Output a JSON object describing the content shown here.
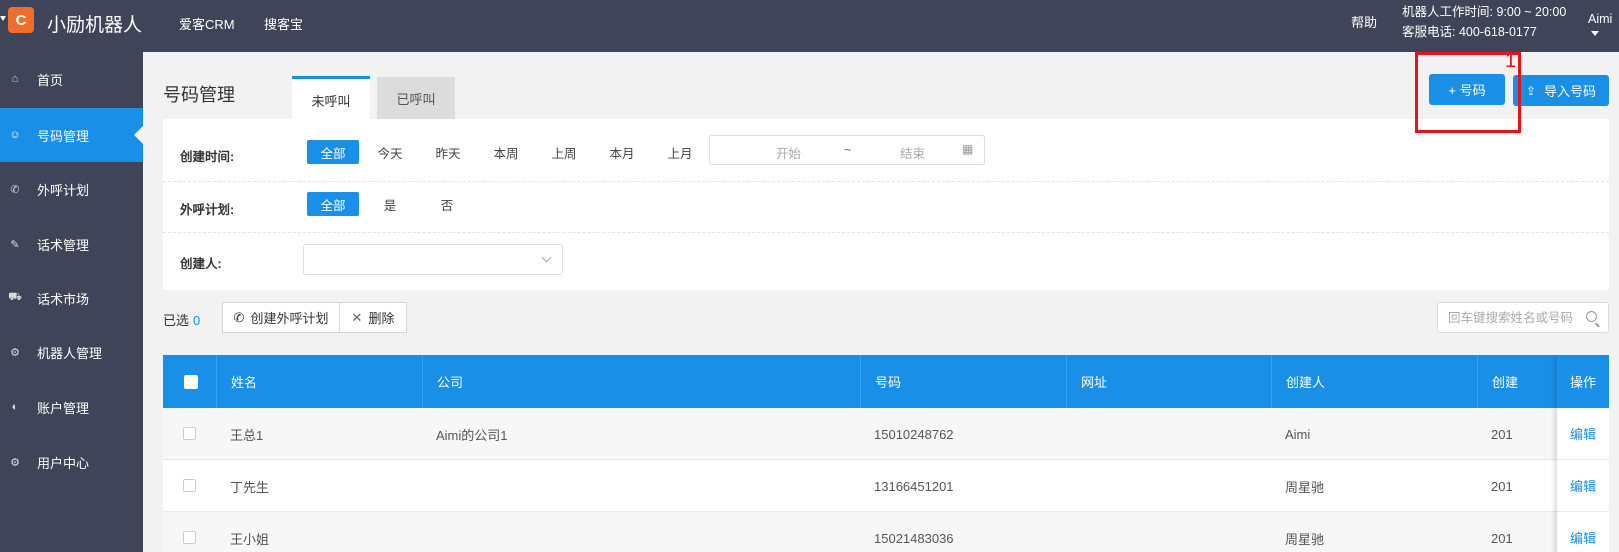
{
  "header": {
    "app_name": "小励机器人",
    "logo_glyph": "C",
    "nav": [
      "爱客CRM",
      "搜客宝"
    ],
    "help": "帮助",
    "work_time": "机器人工作时间: 9:00 ~ 20:00",
    "service_phone": "客服电话: 400-618-0177",
    "user": "Aimi"
  },
  "sidebar": {
    "items": [
      {
        "label": "首页",
        "icon": "⌂"
      },
      {
        "label": "号码管理",
        "icon": "☺"
      },
      {
        "label": "外呼计划",
        "icon": "✆"
      },
      {
        "label": "话术管理",
        "icon": "✎"
      },
      {
        "label": "话术市场",
        "icon": "⛟"
      },
      {
        "label": "机器人管理",
        "icon": "⚙"
      },
      {
        "label": "账户管理",
        "icon": "◐"
      },
      {
        "label": "用户中心",
        "icon": "⚙"
      }
    ]
  },
  "page": {
    "title": "号码管理",
    "tabs": [
      "未呼叫",
      "已呼叫"
    ],
    "add_button": "+ 号码",
    "import_button": "导入号码",
    "annotation_number": "1"
  },
  "filters": {
    "created_time_label": "创建时间:",
    "time_options": [
      "全部",
      "今天",
      "昨天",
      "本周",
      "上周",
      "本月",
      "上月"
    ],
    "date_start": "开始",
    "date_sep": "~",
    "date_end": "结束",
    "plan_label": "外呼计划:",
    "plan_options": [
      "全部",
      "是",
      "否"
    ],
    "creator_label": "创建人:"
  },
  "actions": {
    "selected_label": "已选",
    "selected_count": "0",
    "create_plan": "创建外呼计划",
    "delete": "删除",
    "search_placeholder": "回车键搜索姓名或号码"
  },
  "table": {
    "columns": [
      "姓名",
      "公司",
      "号码",
      "网址",
      "创建人",
      "创建"
    ],
    "ops_header": "操作",
    "edit_label": "编辑",
    "rows": [
      {
        "name": "王总1",
        "company": "Aimi的公司1",
        "phone": "15010248762",
        "url": "",
        "creator": "Aimi",
        "created": "201"
      },
      {
        "name": "丁先生",
        "company": "",
        "phone": "13166451201",
        "url": "",
        "creator": "周星驰",
        "created": "201"
      },
      {
        "name": "王小姐",
        "company": "",
        "phone": "15021483036",
        "url": "",
        "creator": "周星驰",
        "created": "201"
      }
    ]
  },
  "colors": {
    "accent": "#1a8fe8",
    "topbar": "#3f4458",
    "annotation": "#e8131a"
  }
}
